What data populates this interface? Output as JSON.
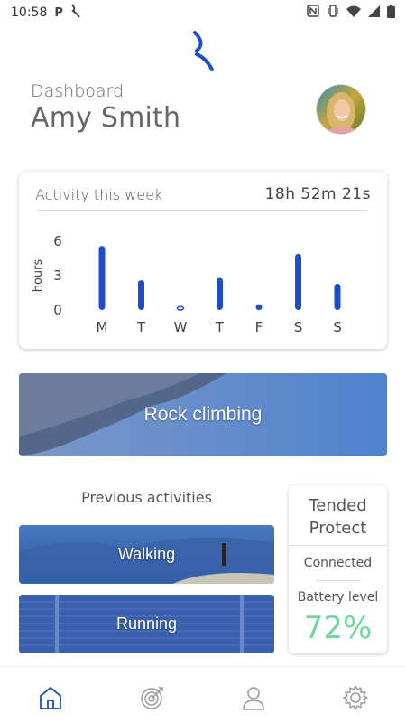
{
  "status_bar": {
    "time": "10:58",
    "left_icons": [
      "parking-icon",
      "swing-app-icon"
    ],
    "right_icons": [
      "nfc-icon",
      "vibrate-icon",
      "wifi-icon",
      "signal-icon",
      "battery-icon"
    ]
  },
  "header": {
    "label": "Dashboard",
    "user_name": "Amy Smith"
  },
  "activity_card": {
    "title": "Activity this week",
    "total_time": "18h 52m 21s"
  },
  "chart_data": {
    "type": "bar",
    "categories": [
      "M",
      "T",
      "W",
      "T",
      "F",
      "S",
      "S"
    ],
    "values": [
      5.6,
      2.6,
      0.3,
      2.8,
      0.5,
      4.9,
      2.3
    ],
    "ylabel": "hours",
    "yticks": [
      0,
      3,
      6
    ],
    "ylim": [
      0,
      6.5
    ],
    "bar_color": "#1f4fc8"
  },
  "featured": {
    "label": "Rock climbing"
  },
  "previous": {
    "title": "Previous activities",
    "items": [
      {
        "label": "Walking"
      },
      {
        "label": "Running"
      }
    ]
  },
  "device": {
    "name": "Tended\nProtect",
    "status": "Connected",
    "battery_label": "Battery level",
    "battery_value": "72%",
    "battery_color": "#6fd89b"
  },
  "nav": {
    "items": [
      {
        "name": "home",
        "icon": "home-icon",
        "active": true
      },
      {
        "name": "goals",
        "icon": "target-icon",
        "active": false
      },
      {
        "name": "profile",
        "icon": "person-icon",
        "active": false
      },
      {
        "name": "settings",
        "icon": "gear-icon",
        "active": false
      }
    ],
    "active_color": "#1f4fc8",
    "inactive_color": "#9a9a9a"
  },
  "colors": {
    "accent": "#1f4fc8"
  }
}
